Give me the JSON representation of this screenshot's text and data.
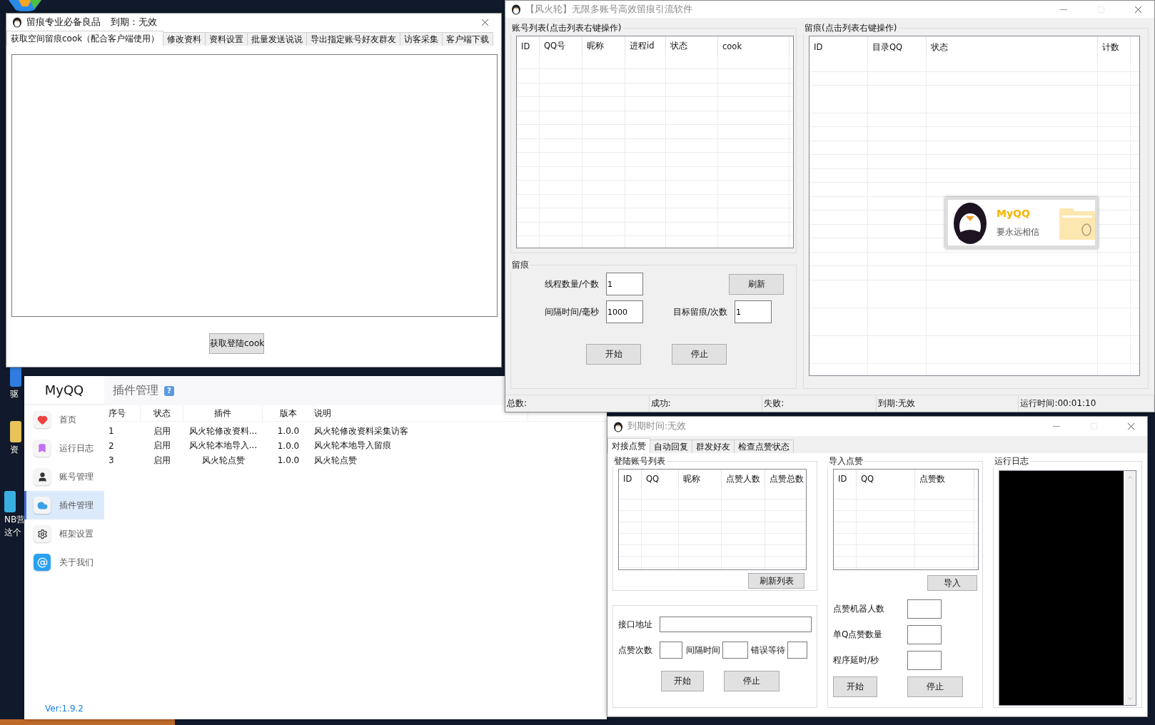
{
  "desktop": {
    "icons": [
      {
        "kind": "app",
        "lines": [
          "驱"
        ]
      },
      {
        "kind": "folder",
        "lines": [
          "资"
        ]
      },
      {
        "kind": "zip",
        "lines": [
          "NB营",
          "这个"
        ]
      }
    ]
  },
  "myqq": {
    "brand": "MyQQ",
    "page_title": "插件管理",
    "help": "?",
    "nav": [
      {
        "label": "首页",
        "kind": "heart",
        "selected": false
      },
      {
        "label": "运行日志",
        "kind": "bookmark",
        "selected": false
      },
      {
        "label": "账号管理",
        "kind": "user",
        "selected": false
      },
      {
        "label": "插件管理",
        "kind": "cloud",
        "selected": true
      },
      {
        "label": "框架设置",
        "kind": "gear",
        "selected": false
      },
      {
        "label": "关于我们",
        "kind": "at",
        "selected": false
      }
    ],
    "table": {
      "columns": [
        "序号",
        "状态",
        "插件",
        "版本",
        "说明"
      ],
      "rows": [
        [
          "1",
          "启用",
          "风火轮修改资料...",
          "1.0.0",
          "风火轮修改资料采集访客"
        ],
        [
          "2",
          "启用",
          "风火轮本地导入...",
          "1.0.0",
          "风火轮本地导入留痕"
        ],
        [
          "3",
          "启用",
          "风火轮点赞",
          "1.0.0",
          "风火轮点赞"
        ]
      ]
    },
    "version": "Ver:1.9.2"
  },
  "cookie_window": {
    "title": "留痕专业必备良品",
    "expiry": "到期：无效",
    "tabs": [
      {
        "label": "获取空间留痕cook（配合客户端使用）",
        "selected": true
      },
      {
        "label": "修改资料",
        "selected": false
      },
      {
        "label": "资料设置",
        "selected": false
      },
      {
        "label": "批量发送说说",
        "selected": false
      },
      {
        "label": "导出指定账号好友群友",
        "selected": false
      },
      {
        "label": "访客采集",
        "selected": false
      },
      {
        "label": "客户端下载",
        "selected": false
      }
    ],
    "button": "获取登陆cook"
  },
  "main_window": {
    "title": "【风火轮】无限多账号高效留痕引流软件",
    "accounts": {
      "title": "账号列表(点击列表右键操作)",
      "columns": [
        "ID",
        "QQ号",
        "昵称",
        "进程id",
        "状态",
        "cook"
      ]
    },
    "trace": {
      "title": "留痕",
      "thread_label": "线程数量/个数",
      "thread_value": "1",
      "refresh": "刷新",
      "interval_label": "间隔时间/毫秒",
      "interval_value": "1000",
      "target_label": "目标留痕/次数",
      "target_value": "1",
      "start": "开始",
      "stop": "停止"
    },
    "traces": {
      "title": "留痕(点击列表右键操作)",
      "columns": [
        "ID",
        "目录QQ",
        "状态",
        "计数"
      ]
    },
    "status_bar": [
      "总数:",
      "成功:",
      "失败:",
      "到期:无效",
      "运行时间:00:01:10"
    ]
  },
  "splash": {
    "brand": "MyQQ",
    "slogan": "要永远相信"
  },
  "like_window": {
    "title": "到期时间:无效",
    "tabs": [
      {
        "label": "对接点赞",
        "selected": true
      },
      {
        "label": "自动回复",
        "selected": false
      },
      {
        "label": "群发好友",
        "selected": false
      },
      {
        "label": "检查点赞状态",
        "selected": false
      }
    ],
    "login": {
      "title": "登陆账号列表",
      "columns": [
        "ID",
        "QQ",
        "昵称",
        "点赞人数",
        "点赞总数"
      ],
      "refresh": "刷新列表"
    },
    "api": {
      "address_label": "接口地址",
      "count_label": "点赞次数",
      "interval_label": "间隔时间",
      "wait_label": "错误等待",
      "start": "开始",
      "stop": "停止"
    },
    "import": {
      "title": "导入点赞",
      "columns": [
        "ID",
        "QQ",
        "点赞数"
      ],
      "import_button": "导入",
      "fields": [
        "点赞机器人数",
        "单Q点赞数量",
        "程序延时/秒"
      ],
      "start": "开始",
      "stop": "停止"
    },
    "log": {
      "title": "运行日志"
    }
  }
}
